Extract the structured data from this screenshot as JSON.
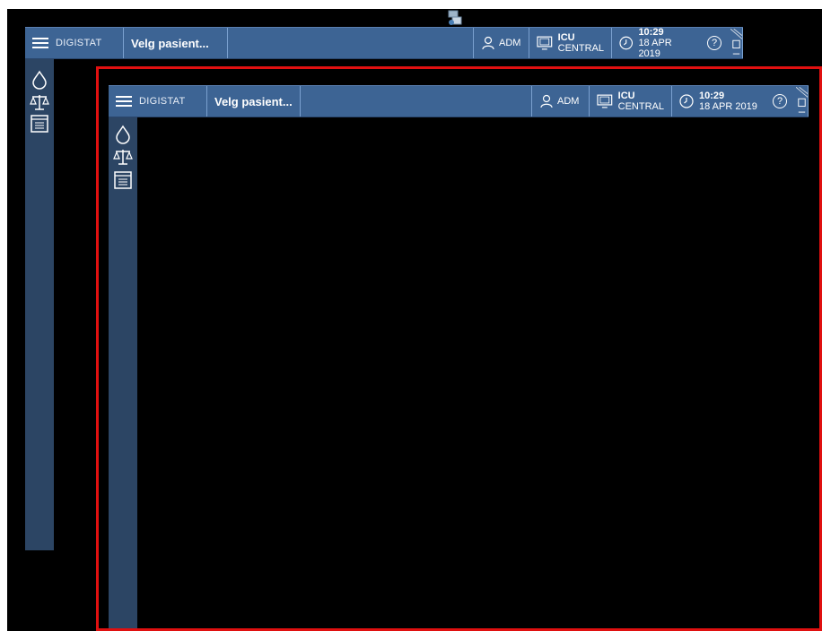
{
  "app": {
    "brand": "DIGISTAT",
    "patient": "Velg pasient...",
    "user": "ADM",
    "workstation": {
      "line1": "ICU",
      "line2": "CENTRAL"
    },
    "clock": {
      "time": "10:29",
      "date": "18 APR 2019"
    },
    "help": "?"
  },
  "sidebar": {
    "icons": [
      "drop-icon",
      "scale-icon",
      "list-icon"
    ]
  },
  "colors": {
    "bar": "#3d6494",
    "sidebar": "#2c4564",
    "highlight": "#e01010",
    "background": "#000000"
  }
}
